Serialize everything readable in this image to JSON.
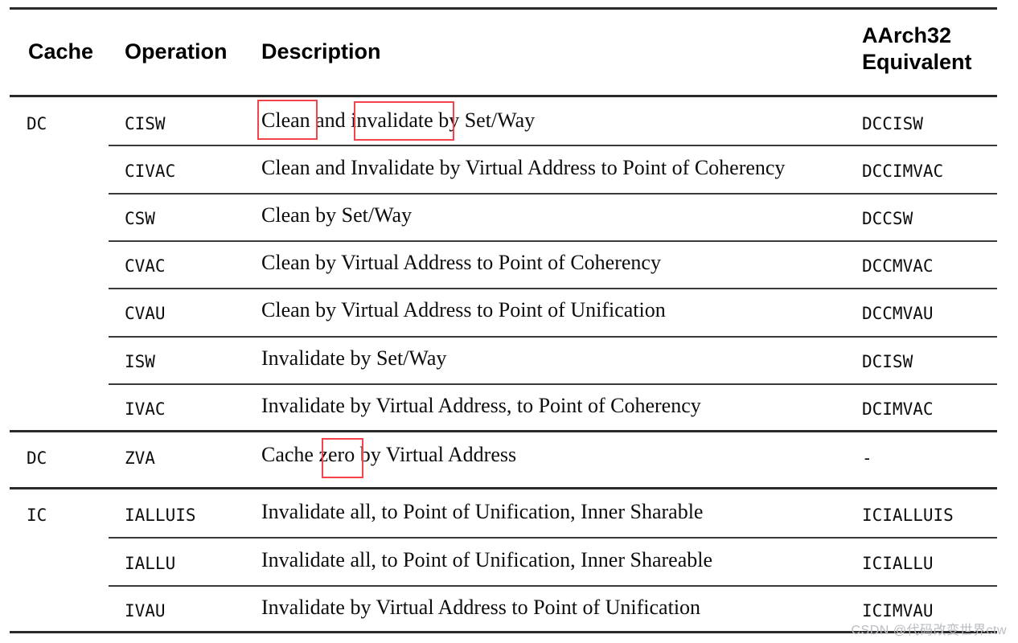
{
  "document": {
    "type": "reference-table",
    "title_visible": false,
    "watermark": "CSDN @代码改变世界ctw"
  },
  "table": {
    "headers": {
      "cache": "Cache",
      "operation": "Operation",
      "description": "Description",
      "aarch32_equivalent": "AArch32\nEquivalent"
    },
    "rows": [
      {
        "cache": "DC",
        "operation": "CISW",
        "description": "Clean and invalidate by Set/Way",
        "aarch32": "DCCISW"
      },
      {
        "cache": "",
        "operation": "CIVAC",
        "description": "Clean and Invalidate by Virtual Address to Point of Coherency",
        "aarch32": "DCCIMVAC"
      },
      {
        "cache": "",
        "operation": "CSW",
        "description": "Clean by Set/Way",
        "aarch32": "DCCSW"
      },
      {
        "cache": "",
        "operation": "CVAC",
        "description": "Clean by Virtual Address to Point of Coherency",
        "aarch32": "DCCMVAC"
      },
      {
        "cache": "",
        "operation": "CVAU",
        "description": "Clean by Virtual Address to Point of Unification",
        "aarch32": "DCCMVAU"
      },
      {
        "cache": "",
        "operation": "ISW",
        "description": "Invalidate by Set/Way",
        "aarch32": "DCISW"
      },
      {
        "cache": "",
        "operation": "IVAC",
        "description": "Invalidate by Virtual Address, to Point of Coherency",
        "aarch32": "DCIMVAC"
      },
      {
        "cache": "DC",
        "operation": "ZVA",
        "description": "Cache zero by Virtual Address",
        "aarch32": "-"
      },
      {
        "cache": "IC",
        "operation": "IALLUIS",
        "description": "Invalidate all, to Point of Unification, Inner Sharable",
        "aarch32": "ICIALLUIS"
      },
      {
        "cache": "",
        "operation": "IALLU",
        "description": "Invalidate all, to Point of Unification, Inner Shareable",
        "aarch32": "ICIALLU"
      },
      {
        "cache": "",
        "operation": "IVAU",
        "description": "Invalidate by Virtual Address to Point of Unification",
        "aarch32": "ICIMVAU"
      }
    ]
  },
  "annotations": {
    "highlight_color": "#f4434a",
    "boxes": [
      {
        "label": "Clean",
        "row": 0,
        "word": "Clean"
      },
      {
        "label": "invalidate",
        "row": 0,
        "word": "invalidate"
      },
      {
        "label": "zero",
        "row": 7,
        "word": "zero"
      }
    ]
  }
}
